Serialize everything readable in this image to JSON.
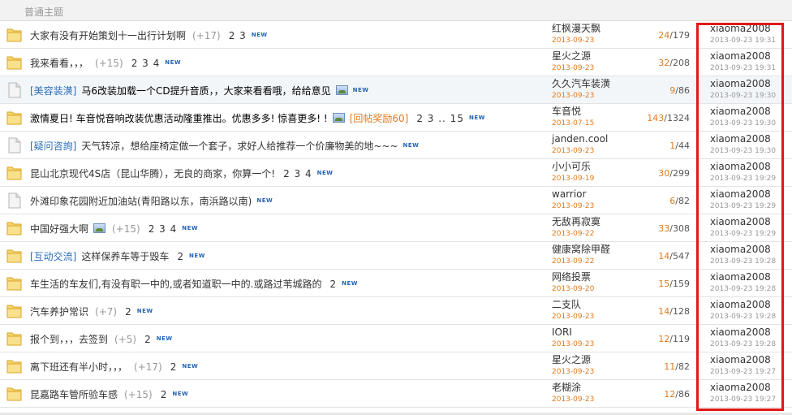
{
  "header": {
    "title": "普通主题"
  },
  "rows": [
    {
      "icon": "folder",
      "category": "",
      "title": "大家有没有开始策划十一出行计划啊",
      "bold": false,
      "hits": "(+17)",
      "pages": "2 3",
      "image": false,
      "reward": "",
      "is_new": true,
      "author": "红枫漫天飘",
      "date": "2013-09-23",
      "replies": "24",
      "views": "179",
      "last_user": "xiaoma2008",
      "last_time": "2013-09-23 19:31"
    },
    {
      "icon": "folder",
      "category": "",
      "title": "我来看看，，，",
      "bold": false,
      "hits": "(+15)",
      "pages": "2 3 4",
      "image": false,
      "reward": "",
      "is_new": true,
      "author": "星火之源",
      "date": "2013-09-23",
      "replies": "32",
      "views": "208",
      "last_user": "xiaoma2008",
      "last_time": "2013-09-23 19:31"
    },
    {
      "icon": "page",
      "category": "[美容装潢]",
      "title": "马6改装加载一个CD提升音质，，大家来看看哦，给给意见",
      "bold": true,
      "hits": "",
      "pages": "",
      "image": true,
      "reward": "",
      "is_new": true,
      "author": "久久汽车装潢",
      "date": "2013-09-23",
      "replies": "9",
      "views": "86",
      "last_user": "xiaoma2008",
      "last_time": "2013-09-23 19:30"
    },
    {
      "icon": "folder",
      "category": "",
      "title": "激情夏日! 车音悦音响改装优惠活动隆重推出。优惠多多! 惊喜更多! !",
      "bold": true,
      "hits": "",
      "pages": "2 3 .. 15",
      "image": true,
      "reward": "[回帖奖励60]",
      "is_new": true,
      "author": "车音悦",
      "date": "2013-07-15",
      "replies": "143",
      "views": "1324",
      "last_user": "xiaoma2008",
      "last_time": "2013-09-23 19:30"
    },
    {
      "icon": "page",
      "category": "[疑问咨詢]",
      "title": "天气转凉，想给座椅定做一个套子，求好人给推荐一个价廉物美的地~~~",
      "bold": false,
      "hits": "",
      "pages": "",
      "image": false,
      "reward": "",
      "is_new": true,
      "author": "janden.cool",
      "date": "2013-09-23",
      "replies": "1",
      "views": "44",
      "last_user": "xiaoma2008",
      "last_time": "2013-09-23 19:30"
    },
    {
      "icon": "folder",
      "category": "",
      "title": "昆山北京现代4S店（昆山华腾），无良的商家，你算一个!",
      "bold": false,
      "hits": "",
      "pages": "2 3 4",
      "image": false,
      "reward": "",
      "is_new": true,
      "author": "小小可乐",
      "date": "2013-09-19",
      "replies": "30",
      "views": "299",
      "last_user": "xiaoma2008",
      "last_time": "2013-09-23 19:29"
    },
    {
      "icon": "page",
      "category": "",
      "title": "外滩印象花园附近加油站(青阳路以东，南浜路以南)",
      "bold": false,
      "hits": "",
      "pages": "",
      "image": false,
      "reward": "",
      "is_new": true,
      "author": "warrior",
      "date": "2013-09-23",
      "replies": "6",
      "views": "82",
      "last_user": "xiaoma2008",
      "last_time": "2013-09-23 19:29"
    },
    {
      "icon": "folder",
      "category": "",
      "title": "中国好强大啊",
      "bold": false,
      "hits": "(+15)",
      "pages": "2 3 4",
      "image": true,
      "reward": "",
      "is_new": true,
      "author": "无敌再寂寞",
      "date": "2013-09-22",
      "replies": "33",
      "views": "308",
      "last_user": "xiaoma2008",
      "last_time": "2013-09-23 19:29"
    },
    {
      "icon": "folder",
      "category": "[互动交流]",
      "title": "这样保养车等于毁车",
      "bold": false,
      "hits": "",
      "pages": "2",
      "image": false,
      "reward": "",
      "is_new": true,
      "author": "健康窝除甲醛",
      "date": "2013-09-22",
      "replies": "14",
      "views": "547",
      "last_user": "xiaoma2008",
      "last_time": "2013-09-23 19:28"
    },
    {
      "icon": "folder",
      "category": "",
      "title": "车生活的车友们,有没有职一中的,或者知道职一中的.或路过苇城路的",
      "bold": false,
      "hits": "",
      "pages": "2",
      "image": false,
      "reward": "",
      "is_new": true,
      "author": "网络投票",
      "date": "2013-09-20",
      "replies": "15",
      "views": "159",
      "last_user": "xiaoma2008",
      "last_time": "2013-09-23 19:28"
    },
    {
      "icon": "folder",
      "category": "",
      "title": "汽车养护常识",
      "bold": false,
      "hits": "(+7)",
      "pages": "2",
      "image": false,
      "reward": "",
      "is_new": true,
      "author": "二支队",
      "date": "2013-09-23",
      "replies": "14",
      "views": "128",
      "last_user": "xiaoma2008",
      "last_time": "2013-09-23 19:28"
    },
    {
      "icon": "folder",
      "category": "",
      "title": "报个到，，，去签到",
      "bold": false,
      "hits": "(+5)",
      "pages": "2",
      "image": false,
      "reward": "",
      "is_new": true,
      "author": "IORI",
      "date": "2013-09-23",
      "replies": "12",
      "views": "119",
      "last_user": "xiaoma2008",
      "last_time": "2013-09-23 19:28"
    },
    {
      "icon": "folder",
      "category": "",
      "title": "离下班还有半小时，，，",
      "bold": false,
      "hits": "(+17)",
      "pages": "2",
      "image": false,
      "reward": "",
      "is_new": true,
      "author": "星火之源",
      "date": "2013-09-23",
      "replies": "11",
      "views": "82",
      "last_user": "xiaoma2008",
      "last_time": "2013-09-23 19:27"
    },
    {
      "icon": "folder",
      "category": "",
      "title": "昆嘉路车管所验车感",
      "bold": false,
      "hits": "(+15)",
      "pages": "2",
      "image": false,
      "reward": "",
      "is_new": true,
      "author": "老糊涂",
      "date": "2013-09-23",
      "replies": "12",
      "views": "86",
      "last_user": "xiaoma2008",
      "last_time": "2013-09-23 19:27"
    }
  ],
  "labels": {
    "new_badge": "NEW",
    "stats_separator": "/"
  },
  "colors": {
    "accent_orange": "#e07b1f",
    "link_blue": "#2a6eb8",
    "highlight_red": "#e01818"
  },
  "highlighted_row_index": 2
}
